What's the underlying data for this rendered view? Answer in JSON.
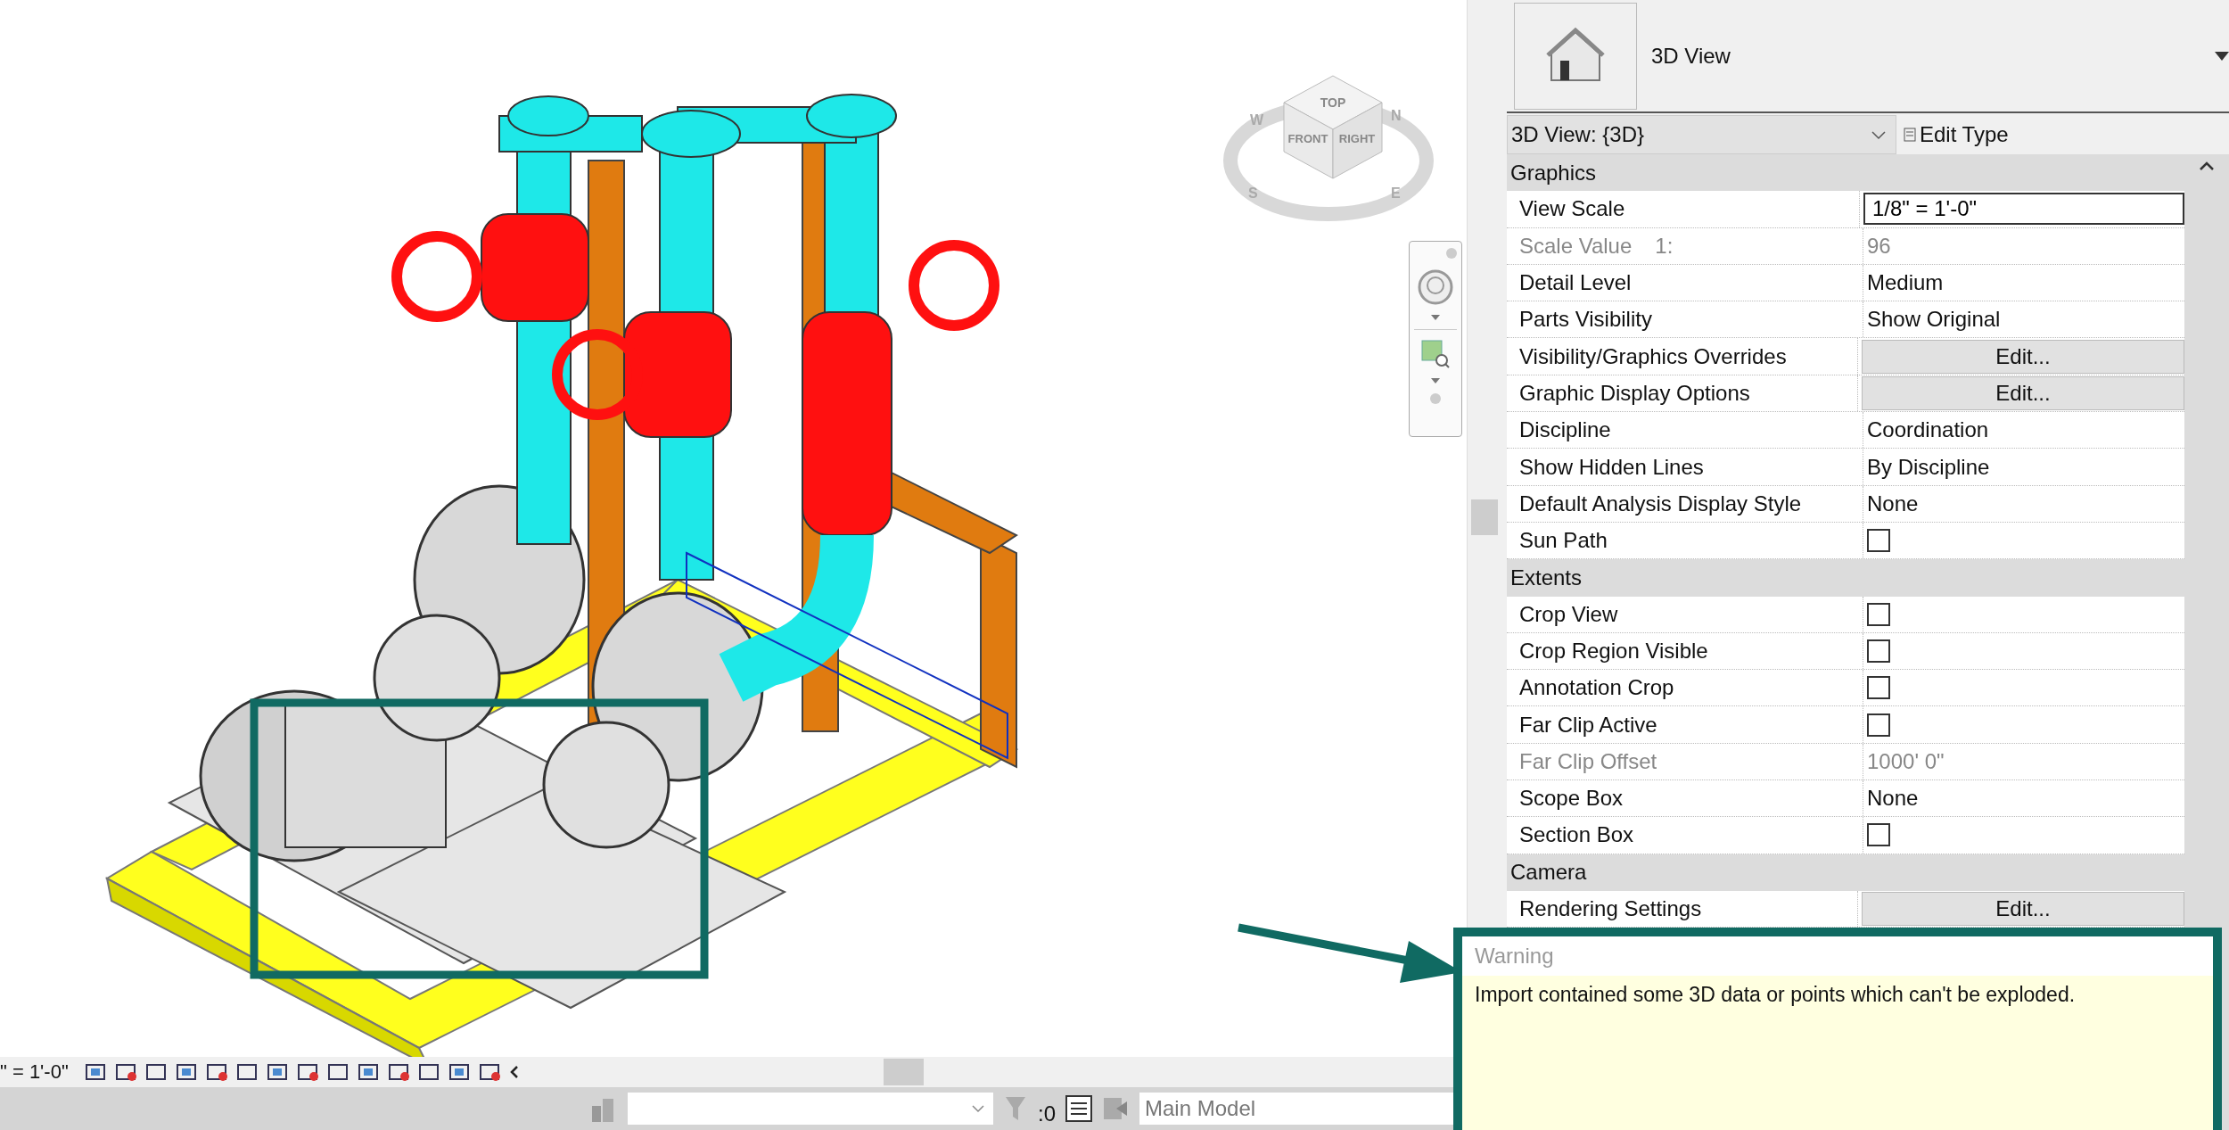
{
  "view_cube": {
    "faces": [
      "TOP",
      "FRONT",
      "RIGHT"
    ],
    "compass": [
      "W",
      "N",
      "S",
      "E"
    ]
  },
  "view_bar": {
    "scale": "\" = 1'-0\""
  },
  "status_bar": {
    "count": ":0",
    "model": "Main Model"
  },
  "properties": {
    "family_label": "3D View",
    "type_selector": "3D View: {3D}",
    "edit_type": "Edit Type",
    "sections": [
      {
        "title": "Graphics",
        "rows": [
          {
            "label": "View Scale",
            "kind": "input",
            "value": "1/8\" = 1'-0\""
          },
          {
            "label": "Scale Value",
            "suffix": "1:",
            "kind": "readonly",
            "value": "96"
          },
          {
            "label": "Detail Level",
            "kind": "text",
            "value": "Medium"
          },
          {
            "label": "Parts Visibility",
            "kind": "text",
            "value": "Show Original"
          },
          {
            "label": "Visibility/Graphics Overrides",
            "kind": "button",
            "value": "Edit..."
          },
          {
            "label": "Graphic Display Options",
            "kind": "button",
            "value": "Edit..."
          },
          {
            "label": "Discipline",
            "kind": "text",
            "value": "Coordination"
          },
          {
            "label": "Show Hidden Lines",
            "kind": "text",
            "value": "By Discipline"
          },
          {
            "label": "Default Analysis Display Style",
            "kind": "text",
            "value": "None"
          },
          {
            "label": "Sun Path",
            "kind": "checkbox",
            "checked": false
          }
        ]
      },
      {
        "title": "Extents",
        "rows": [
          {
            "label": "Crop View",
            "kind": "checkbox",
            "checked": false
          },
          {
            "label": "Crop Region Visible",
            "kind": "checkbox",
            "checked": false
          },
          {
            "label": "Annotation Crop",
            "kind": "checkbox",
            "checked": false
          },
          {
            "label": "Far Clip Active",
            "kind": "checkbox",
            "checked": false
          },
          {
            "label": "Far Clip Offset",
            "kind": "readonly",
            "value": "1000'  0\""
          },
          {
            "label": "Scope Box",
            "kind": "text",
            "value": "None"
          },
          {
            "label": "Section Box",
            "kind": "checkbox",
            "checked": false
          }
        ]
      },
      {
        "title": "Camera",
        "rows": [
          {
            "label": "Rendering Settings",
            "kind": "button",
            "value": "Edit..."
          }
        ]
      }
    ]
  },
  "warning": {
    "title": "Warning",
    "message": "Import contained some 3D data or points which can't be exploded."
  }
}
